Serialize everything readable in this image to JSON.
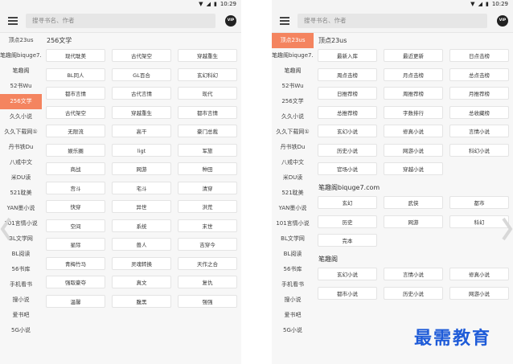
{
  "status_time": "10:29",
  "search_placeholder": "搜寻书名、作者",
  "vip_label": "VIP",
  "sidebar_items": [
    "顶点23us",
    "笔趣阁biquge7...",
    "笔趣阁",
    "52书Wu",
    "256文学",
    "久久小说",
    "久久下载网①",
    "丹书铁Du",
    "八戒中文",
    "米DU读",
    "521耽美",
    "YAN墨小说",
    "101言情小说",
    "BL文学网",
    "BL阅读",
    "56书库",
    "手机看书",
    "搜小说",
    "爱书吧",
    "5G小说"
  ],
  "left_panel": {
    "active_index": 4,
    "section_title": "256文学",
    "categories": [
      "现代耽美",
      "古代架空",
      "穿越重生",
      "BL同人",
      "GL百合",
      "玄幻科幻",
      "都市言情",
      "古代言情",
      "现代",
      "古代架空",
      "穿越重生",
      "都市言情",
      "无限流",
      "高干",
      "豪门总裁",
      "娱乐圈",
      "ligt",
      "军旅",
      "商战",
      "网游",
      "种田",
      "宫斗",
      "宅斗",
      "清穿",
      "快穿",
      "异世",
      "洪荒",
      "空间",
      "系统",
      "末世",
      "星际",
      "兽人",
      "吉穿今",
      "青梅竹马",
      "灵魂转换",
      "天作之合",
      "强取豪夺",
      "真文",
      "复仇",
      "温馨",
      "腹黑",
      "强强"
    ]
  },
  "right_panel": {
    "active_index": 0,
    "sections": [
      {
        "title": "顶点23us",
        "items": [
          "最新入库",
          "最近更新",
          "日点击榜",
          "周点击榜",
          "月点击榜",
          "总点击榜",
          "日推荐榜",
          "周推荐榜",
          "月推荐榜",
          "总推荐榜",
          "字数排行",
          "总收藏榜",
          "玄幻小说",
          "修真小说",
          "言情小说",
          "历史小说",
          "网游小说",
          "科幻小说",
          "官场小说",
          "穿越小说"
        ]
      },
      {
        "title": "笔趣阁biquge7.com",
        "items": [
          "玄幻",
          "武侠",
          "都市",
          "历史",
          "网游",
          "科幻",
          "完本"
        ]
      },
      {
        "title": "笔趣阁",
        "items": [
          "玄幻小说",
          "言情小说",
          "修真小说",
          "都市小说",
          "历史小说",
          "网游小说"
        ]
      }
    ]
  },
  "watermark": "最需教育"
}
